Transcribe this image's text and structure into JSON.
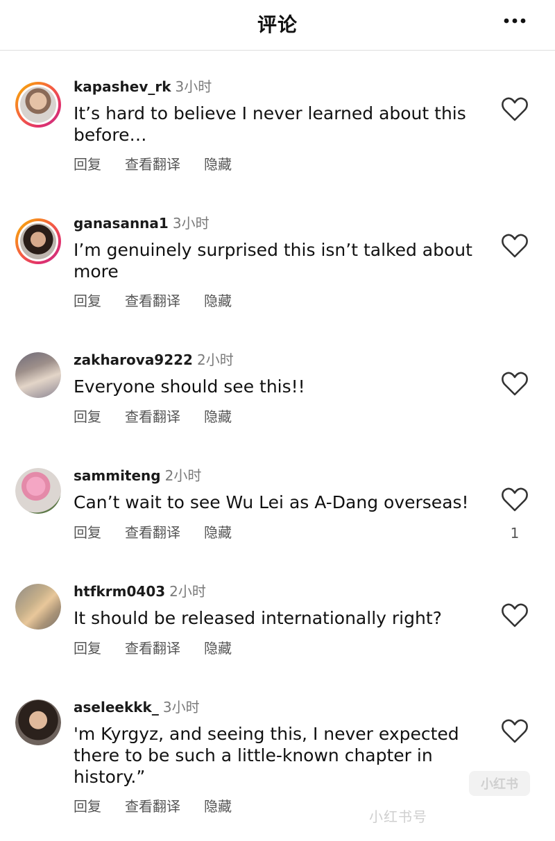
{
  "header": {
    "title": "评论",
    "more_icon": "more-horizontal-icon"
  },
  "comments": [
    {
      "username": "kapashev_rk",
      "time": "3小时",
      "text": "It’s hard to believe I never learned about this before…",
      "actions": [
        "回复",
        "查看翻译",
        "隐藏"
      ],
      "avatar_ring": true,
      "like_count": ""
    },
    {
      "username": "ganasanna1",
      "time": "3小时",
      "text": "I’m genuinely surprised this isn’t talked about more",
      "actions": [
        "回复",
        "查看翻译",
        "隐藏"
      ],
      "avatar_ring": true,
      "like_count": ""
    },
    {
      "username": "zakharova9222",
      "time": "2小时",
      "text": "Everyone should see this!!",
      "actions": [
        "回复",
        "查看翻译",
        "隐藏"
      ],
      "avatar_ring": false,
      "like_count": ""
    },
    {
      "username": "sammiteng",
      "time": "2小时",
      "text": "Can’t wait to see Wu Lei as A-Dang overseas!",
      "actions": [
        "回复",
        "查看翻译",
        "隐藏"
      ],
      "avatar_ring": false,
      "like_count": "1"
    },
    {
      "username": "htfkrm0403",
      "time": "2小时",
      "text": "It should be released internationally right?",
      "actions": [
        "回复",
        "查看翻译",
        "隐藏"
      ],
      "avatar_ring": false,
      "like_count": ""
    },
    {
      "username": "aseleekkk_",
      "time": "3小时",
      "text": "'m Kyrgyz, and seeing this, I never expected there to be such a little-known chapter in history.”",
      "actions": [
        "回复",
        "查看翻译",
        "隐藏"
      ],
      "avatar_ring": false,
      "like_count": ""
    }
  ],
  "watermark": {
    "text": "小红书号",
    "logo_text": "小红书"
  },
  "colors": {
    "text_primary": "#111111",
    "text_secondary": "#7a7a7a",
    "action_text": "#555555",
    "ring_gradient": [
      "#f7b500",
      "#f56040",
      "#e1306c",
      "#c13584"
    ]
  }
}
